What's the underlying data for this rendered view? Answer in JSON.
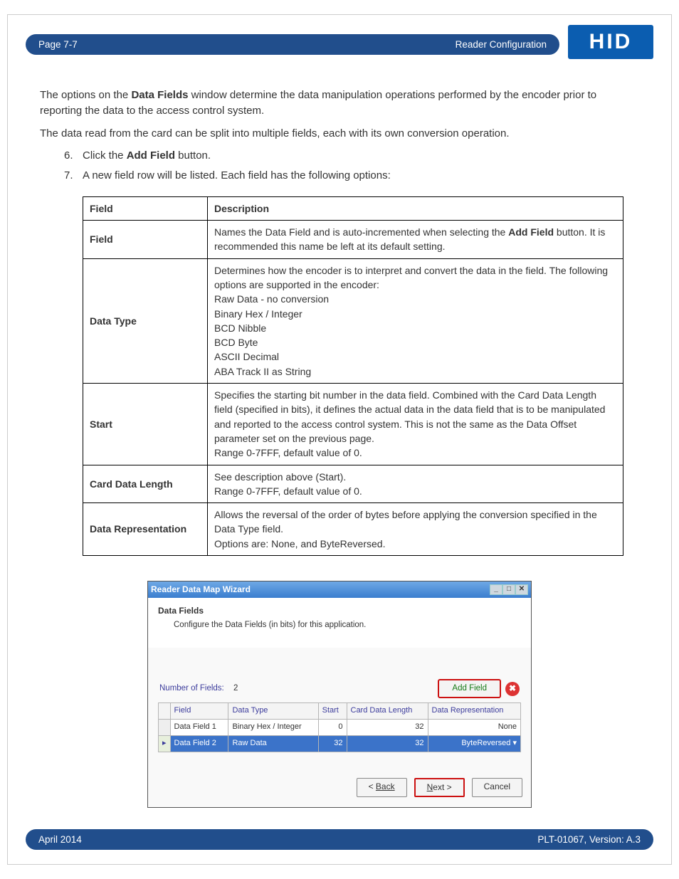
{
  "header": {
    "page_label": "Page 7-7",
    "section_label": "Reader Configuration",
    "logo_text": "HID"
  },
  "intro": {
    "p1a": "The options on the ",
    "p1b": "Data Fields",
    "p1c": " window determine the data manipulation operations performed by the encoder prior to reporting the data to the access control system.",
    "p2": "The data read from the card can be split into multiple fields, each with its own conversion operation."
  },
  "steps": {
    "s6_num": "6.",
    "s6a": "Click the ",
    "s6b": "Add Field",
    "s6c": " button.",
    "s7_num": "7.",
    "s7": "A new field row will be listed. Each field has the following options:"
  },
  "table": {
    "h1": "Field",
    "h2": "Description",
    "r1_label": "Field",
    "r1_a": "Names the Data Field and is auto-incremented when selecting the ",
    "r1_b": "Add Field",
    "r1_c": " button. It is recommended this name be left at its default setting.",
    "r2_label": "Data Type",
    "r2_l1": "Determines how the encoder is to interpret and convert the data in the field. The following options are supported in the encoder:",
    "r2_l2": "Raw Data - no conversion",
    "r2_l3": "Binary Hex / Integer",
    "r2_l4": "BCD Nibble",
    "r2_l5": "BCD Byte",
    "r2_l6": "ASCII Decimal",
    "r2_l7": "ABA Track II as String",
    "r3_label": "Start",
    "r3_l1": "Specifies the starting bit number in the data field. Combined with the Card Data Length field (specified in bits), it defines the actual data in the data field that is to be manipulated and reported to the access control system. This is not the same as the Data Offset parameter set on the previous page.",
    "r3_l2": "Range 0-7FFF, default value of 0.",
    "r4_label": "Card Data Length",
    "r4_l1": "See description above (Start).",
    "r4_l2": "Range 0-7FFF, default value of 0.",
    "r5_label": "Data Representation",
    "r5_l1": "Allows the reversal of the order of bytes before applying the conversion specified in the Data Type field.",
    "r5_l2": "Options are: None, and ByteReversed."
  },
  "wizard": {
    "title": "Reader Data Map Wizard",
    "head_h1": "Data Fields",
    "head_h2": "Configure the Data Fields (in bits) for this application.",
    "nof_label": "Number of Fields:",
    "nof_value": "2",
    "add_field_label": "Add Field",
    "delete_glyph": "✖",
    "columns": {
      "field": "Field",
      "datatype": "Data Type",
      "start": "Start",
      "cdl": "Card Data Length",
      "rep": "Data Representation"
    },
    "rows": [
      {
        "indicator": "",
        "field": "Data Field 1",
        "datatype": "Binary Hex / Integer",
        "start": "0",
        "cdl": "32",
        "rep": "None"
      },
      {
        "indicator": "▸",
        "field": "Data Field 2",
        "datatype": "Raw Data",
        "start": "32",
        "cdl": "32",
        "rep": "ByteReversed ▾"
      }
    ],
    "back_label": "Back",
    "next_label": "Next >",
    "cancel_label": "Cancel",
    "lt": "< "
  },
  "footer": {
    "left": "April 2014",
    "right": "PLT-01067, Version: A.3"
  }
}
